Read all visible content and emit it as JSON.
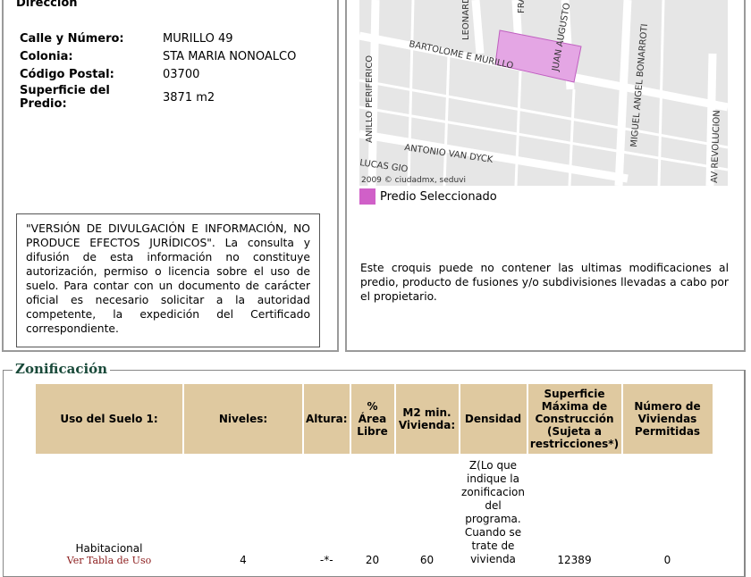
{
  "direccion": {
    "title": "Dirección",
    "rows": [
      {
        "label": "Calle y Número:",
        "value": "MURILLO 49"
      },
      {
        "label": "Colonia:",
        "value": "STA MARIA NONOALCO"
      },
      {
        "label": "Código Postal:",
        "value": "03700"
      },
      {
        "label": "Superficie del Predio:",
        "value": "3871 m2"
      }
    ],
    "notice": "\"VERSIÓN DE DIVULGACIÓN E INFORMACIÓN, NO PRODUCE EFECTOS JURÍDICOS\". La consulta y difusión de esta información no constituye autorización, permiso o licencia sobre el uso de suelo. Para contar con un documento de carácter oficial es necesario solicitar a la autoridad competente, la expedición del Certificado correspondiente."
  },
  "map": {
    "streets": [
      "BARTOLOME E MURILLO",
      "ANILLO PERIFERICO",
      "LEONARDO",
      "FRA",
      "JUAN AUGUSTO",
      "MIGUEL ANGEL BONARROTI",
      "AV REVOLUCION",
      "ANTONIO VAN DYCK",
      "LUCAS GIO"
    ],
    "credit": "2009 © ciudadmx, seduvi",
    "legend": "Predio Seleccionado",
    "highlight_color": "#d060c8",
    "note": "Este croquis puede no contener las ultimas modificaciones al predio, producto de fusiones y/o subdivisiones llevadas a cabo por el propietario."
  },
  "zonificacion": {
    "title": "Zonificación",
    "headers": [
      "Uso del Suelo 1:",
      "Niveles:",
      "Altura:",
      "% Área Libre",
      "M2 min. Vivienda:",
      "Densidad",
      "Superficie Máxima de Construcción (Sujeta a restricciones*)",
      "Número de Viviendas Permitidas"
    ],
    "row": {
      "uso": "Habitacional",
      "link": "Ver Tabla de Uso",
      "niveles": "4",
      "altura": "-*-",
      "area_libre": "20",
      "m2_min": "60",
      "densidad": "Z(Lo que indique la zonificacion del programa. Cuando se trate de vivienda",
      "superficie": "12389",
      "viviendas": "0"
    }
  }
}
